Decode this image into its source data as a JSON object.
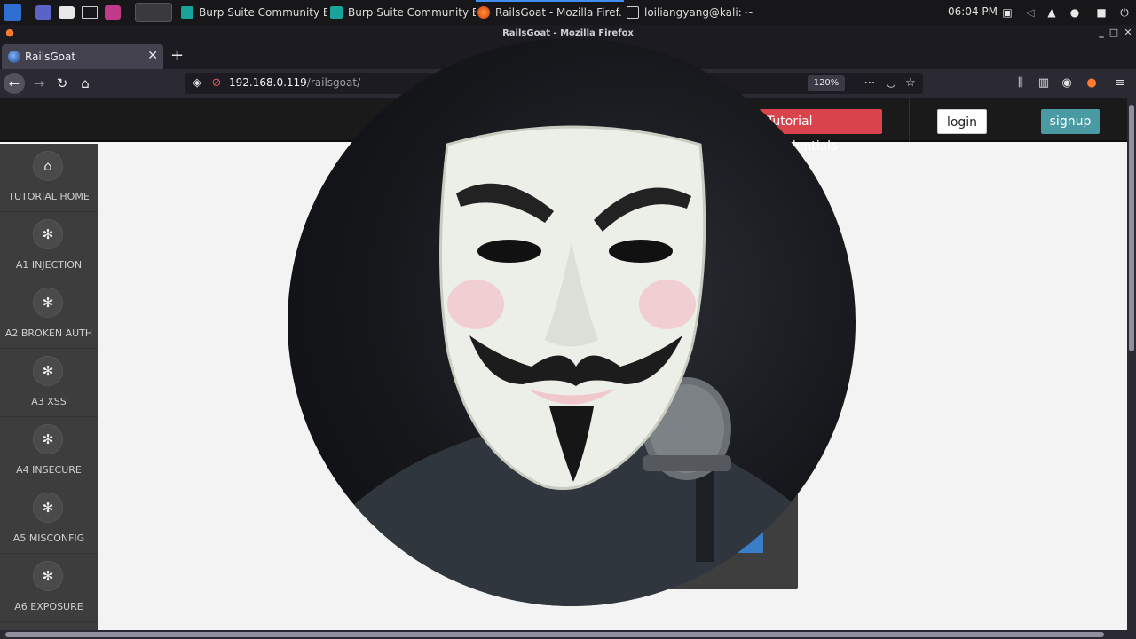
{
  "taskbar": {
    "tasks": [
      {
        "label": "Burp Suite Community E..."
      },
      {
        "label": "Burp Suite Community E..."
      },
      {
        "label": "RailsGoat - Mozilla Firef..."
      },
      {
        "label": "loiliangyang@kali: ~"
      }
    ],
    "time": "06:04 PM"
  },
  "window": {
    "title": "RailsGoat - Mozilla Firefox"
  },
  "browser": {
    "tab_title": "RailsGoat",
    "url_host": "192.168.0.119",
    "url_path": "/railsgoat/",
    "zoom": "120%"
  },
  "header": {
    "tutorial_credentials": "Tutorial Credentials",
    "login": "login",
    "signup": "signup"
  },
  "sidebar": {
    "items": [
      {
        "label": "TUTORIAL HOME",
        "icon": "home-icon"
      },
      {
        "label": "A1 INJECTION",
        "icon": "bug-icon"
      },
      {
        "label": "A2 BROKEN AUTH",
        "icon": "bug-icon"
      },
      {
        "label": "A3 XSS",
        "icon": "bug-icon"
      },
      {
        "label": "A4 INSECURE",
        "icon": "bug-icon"
      },
      {
        "label": "A5 MISCONFIG",
        "icon": "bug-icon"
      },
      {
        "label": "A6 EXPOSURE",
        "icon": "bug-icon"
      }
    ]
  },
  "colors": {
    "danger": "#d9434c",
    "signup": "#4a9aa4",
    "sidebar": "#3d3d3d",
    "firefox_tab": "#42414d"
  }
}
